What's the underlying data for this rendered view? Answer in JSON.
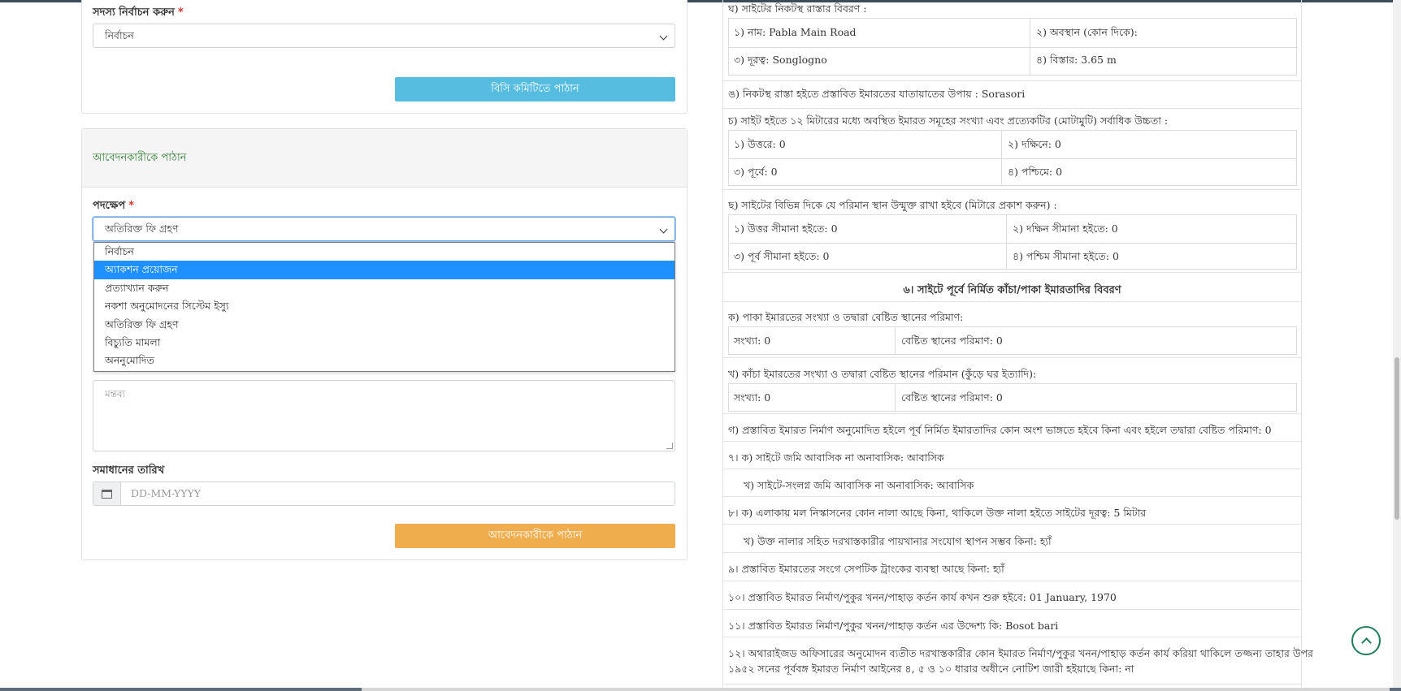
{
  "left": {
    "member_select": {
      "label": "সদস্য নির্বাচন করুন",
      "required_mark": "*",
      "value": "নির্বাচন"
    },
    "send_bc_button": "বিসি কমিটিতে পাঠান",
    "applicant_panel_title": "আবেদনকারীকে পাঠান",
    "action_select": {
      "label": "পদক্ষেপ",
      "required_mark": "*",
      "value": "অতিরিক্ত ফি গ্রহণ",
      "options": [
        "নির্বাচন",
        "অ্যাকশন প্রয়োজন",
        "প্রত্যাখ্যান করুন",
        "নকশা অনুমোদনের সিস্টেম ইস্যু",
        "অতিরিক্ত ফি গ্রহণ",
        "বিচ্যুতি মামলা",
        "অননুমোদিত"
      ],
      "highlighted_option": "অ্যাকশন প্রয়োজন"
    },
    "comment_placeholder": "মন্তব্য",
    "resolution_date": {
      "label": "সমাধানের তারিখ",
      "placeholder": "DD-MM-YYYY",
      "icon": "calendar-icon"
    },
    "send_applicant_button": "আবেদনকারীকে পাঠান"
  },
  "right": {
    "road_heading": "ঘ) সাইটের নিকটস্থ রাস্তার বিবরণ :",
    "road_name": "১) নাম: Pabla Main Road",
    "road_position": "২) অবস্থান (কোন দিকে):",
    "road_distance": "৩) দূরত্ব: Songlogno",
    "road_width": "৪) বিস্তার: 3.65 m",
    "access_mode": "ঙ) নিকটস্থ রাস্তা হইতে প্রস্তাবিত ইমারতের যাতায়াতের উপায় : Sorasori",
    "buildings_heading": "চ) সাইট হইতে ১২ মিটারের মধ্যে অবস্থিত ইমারত সমূহের সংখ্যা এবং প্রত্যেকটির (মোটামুটি) সর্বাধিক উচ্চতা :",
    "north": "১) উত্তরে: 0",
    "south": "২) দক্ষিনে: 0",
    "east": "৩) পূর্বে: 0",
    "west": "৪) পশ্চিমে: 0",
    "open_space_heading": "ছ) সাইটের বিভিন্ন দিকে যে পরিমান স্থান উন্মুক্ত রাখা হইবে (মিটারে প্রকাশ করুন) :",
    "north_boundary": "১) উত্তর সীমানা হইতে: 0",
    "south_boundary": "২) দক্ষিন সীমানা হইতে: 0",
    "east_boundary": "৩) পূর্ব সীমানা হইতে: 0",
    "west_boundary": "৪) পশ্চিম সীমানা হইতে: 0",
    "section6_title": "৬। সাইটে পূর্বে নির্মিত কাঁচা/পাকা ইমারতাদির বিবরণ",
    "pucca_heading": "ক) পাকা ইমারতের সংখ্যা ও তদ্বারা বেষ্টিত স্থানের পরিমাণ:",
    "pucca_count": "সংখ্যা: 0",
    "pucca_area": "বেষ্টিত স্থানের পরিমাণ: 0",
    "kutcha_heading": "খ) কাঁচা ইমারতের সংখ্যা ও তদ্বারা বেষ্টিত স্থানের পরিমান (কুঁড়ে ঘর ইত্যাদি):",
    "kutcha_count": "সংখ্যা: 0",
    "kutcha_area": "বেষ্টিত স্থানের পরিমাণ: 0",
    "demolish": "গ) প্রস্তাবিত ইমারত নির্মাণ অনুমোদিত হইলে পূর্ব নির্মিত ইমারতাদির কোন অংশ ভাঙ্গতে হইবে কিনা এবং হইলে তদ্বারা বেষ্টিত পরিমাণ: 0",
    "land_use_a": "৭। ক) সাইটে জমি আবাসিক না অনাবাসিক: আবাসিক",
    "land_use_b": "খ) সাইটে-সংলগ্ন জমি আবাসিক না অনাবাসিক: আবাসিক",
    "drain_a": "৮। ক) এলাকায় মল নিস্কাসনের কোন নালা আছে কিনা, থাকিলে উক্ত নালা হইতে সাইটের দূরত্ব: 5 মিটার",
    "drain_b": "খ) উক্ত নালার সহিত দরখাস্তকারীর পায়খানার সংযোগ স্থাপন সম্ভব কিনা: হ্যাঁ",
    "septic": "৯। প্রস্তাবিত ইমারতের সংগে সেপটিক ট্রাংকের ব্যবস্থা আছে কিনা: হ্যাঁ",
    "start_date": "১০। প্রস্তাবিত ইমারত নির্মাণ/পুকুর খনন/পাহাড় কর্তন কার্য কখন শুরু হইবে: 01 January, 1970",
    "purpose": "১১। প্রস্তাবিত ইমারত নির্মাণ/পুকুর খনন/পাহাড় কর্তন এর উদ্দেশ্য কি: Bosot bari",
    "notice_line1": "১২। অথারাইজড অফিসারের অনুমোদন ব্যতীত দরখাস্তকারীর কোন ইমারত নির্মাণ/পুকুর খনন/পাহাড় কর্তন কার্য করিয়া থাকিলে তজ্জন্য তাহার উপর",
    "notice_line2": "১৯৫২ সনের পূর্ববঙ্গ ইমারত নির্মাণ আইনের ৪, ৫ ও ১০ ধারার অধীনে নোটিশ জারী হইয়াছে কিনা: না"
  },
  "colors": {
    "info_button": "#56bde0",
    "warning_button": "#f0ad4e",
    "panel_title": "#2f7d2f",
    "required": "#d9322c",
    "highlight": "#1e90ff",
    "back_to_top": "#1e7e5a"
  },
  "icons": {
    "back_to_top": "chevron-up-circle-icon",
    "dropdown": "chevron-down-icon"
  }
}
